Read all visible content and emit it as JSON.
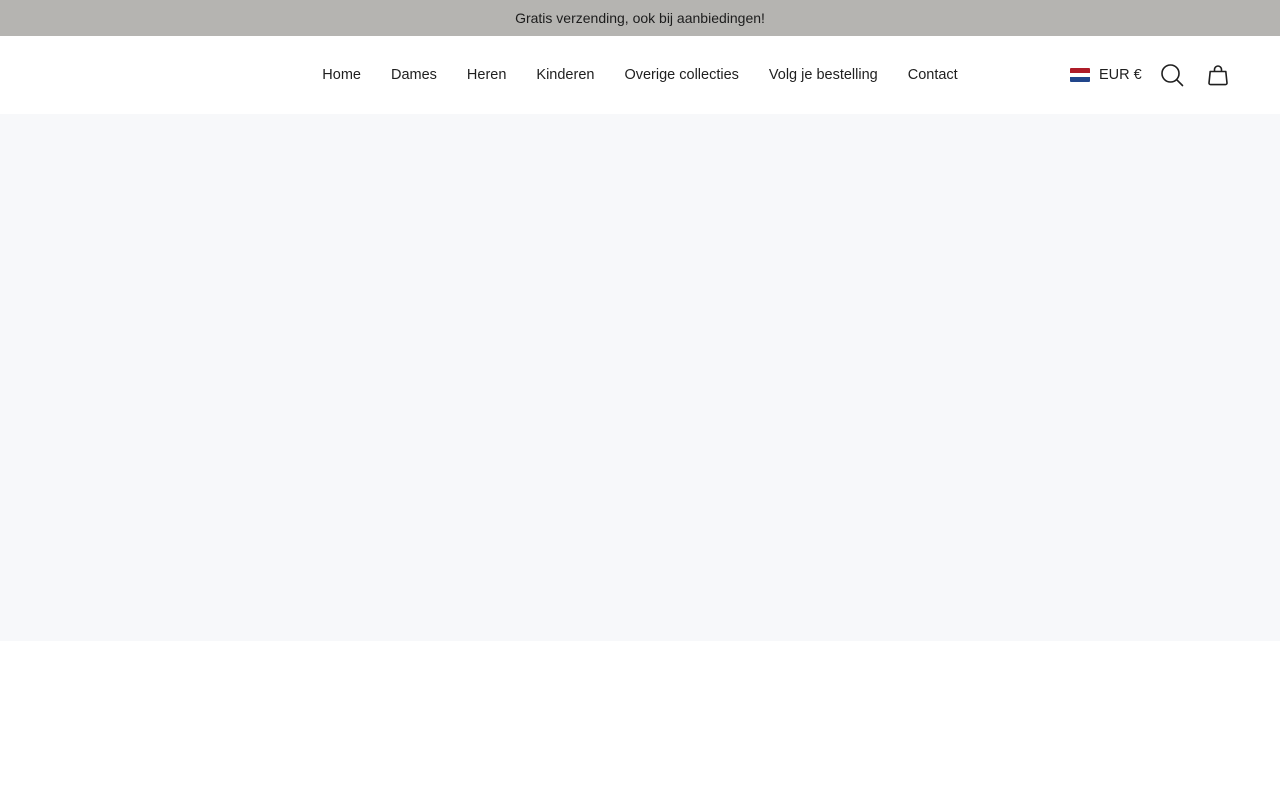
{
  "announcement": {
    "text": "Gratis verzending, ook bij aanbiedingen!"
  },
  "nav": {
    "items": [
      {
        "label": "Home"
      },
      {
        "label": "Dames"
      },
      {
        "label": "Heren"
      },
      {
        "label": "Kinderen"
      },
      {
        "label": "Overige collecties"
      },
      {
        "label": "Volg je bestelling"
      },
      {
        "label": "Contact"
      }
    ]
  },
  "currency": {
    "label": "EUR €",
    "flag": "netherlands-flag-icon"
  },
  "icons": {
    "search": "search-icon",
    "cart": "cart-icon"
  },
  "colors": {
    "announcement_bg": "#b5b4b1",
    "hero_bg": "#f7f8fa",
    "text": "#1f1f1f"
  }
}
